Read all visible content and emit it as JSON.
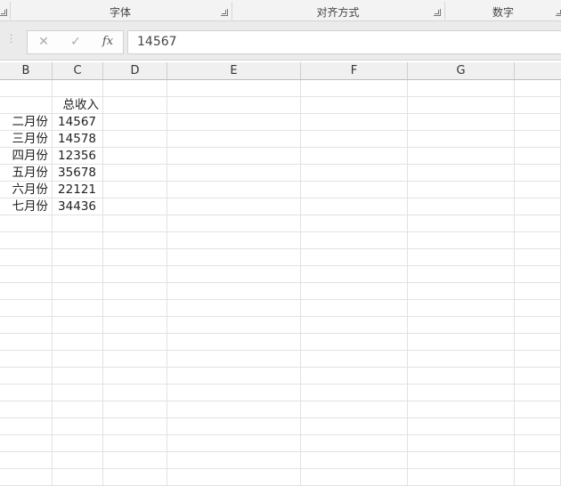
{
  "ribbon": {
    "groups": [
      {
        "label": "字体"
      },
      {
        "label": "对齐方式"
      },
      {
        "label": "数字"
      }
    ]
  },
  "formula_bar": {
    "cancel_icon": "✕",
    "enter_icon": "✓",
    "fx_label": "fx",
    "value": "14567"
  },
  "columns": [
    "B",
    "C",
    "D",
    "E",
    "F",
    "G"
  ],
  "sheet": {
    "header_row": {
      "c": "总收入"
    },
    "rows": [
      {
        "b": "二月份",
        "c": "14567"
      },
      {
        "b": "三月份",
        "c": "14578"
      },
      {
        "b": "四月份",
        "c": "12356"
      },
      {
        "b": "五月份",
        "c": "35678"
      },
      {
        "b": "六月份",
        "c": "22121"
      },
      {
        "b": "七月份",
        "c": "34436"
      }
    ]
  }
}
